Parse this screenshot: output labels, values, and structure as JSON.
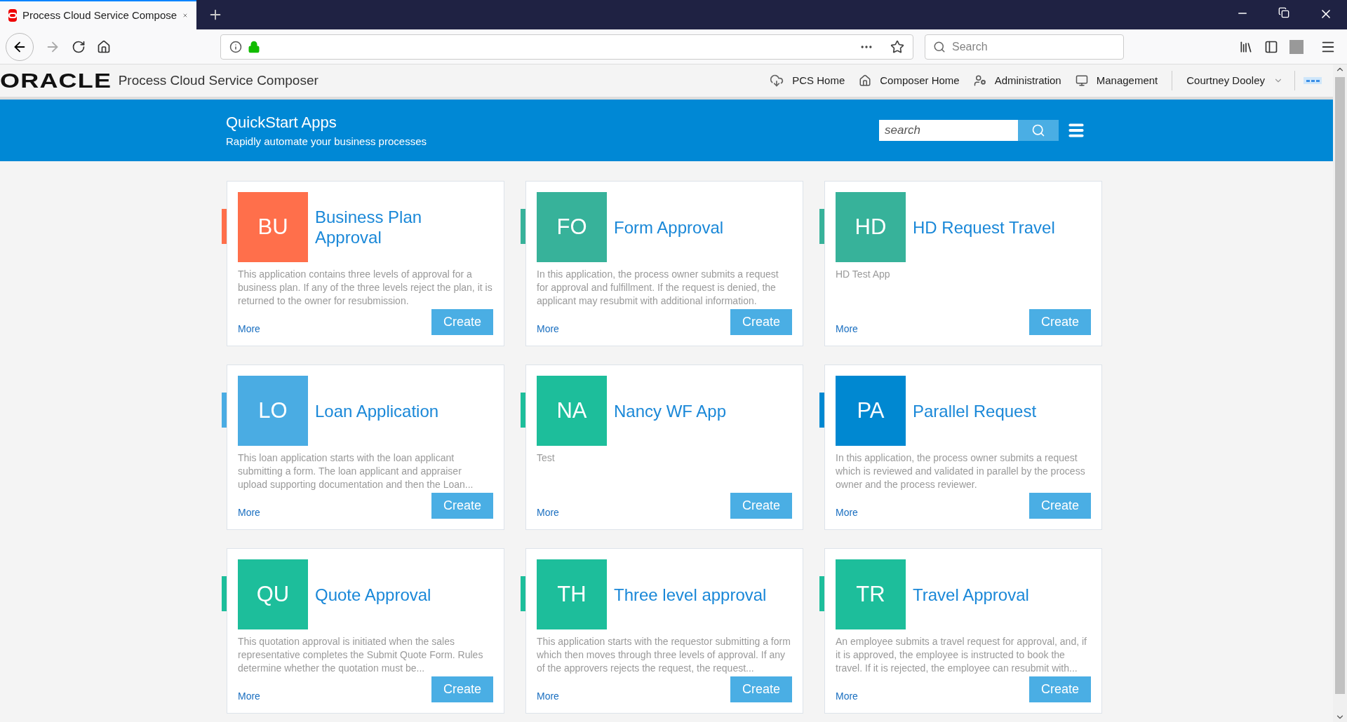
{
  "browser": {
    "tab": {
      "title": "Process Cloud Service Compose",
      "selected": true
    },
    "search": {
      "placeholder": "Search"
    }
  },
  "header": {
    "logo": "ORACLE",
    "product": "Process Cloud Service Composer",
    "nav": [
      {
        "kind": "cloud",
        "label": "PCS Home"
      },
      {
        "kind": "home",
        "label": "Composer Home"
      },
      {
        "kind": "admin",
        "label": "Administration"
      },
      {
        "kind": "monitor",
        "label": "Management"
      }
    ],
    "user": "Courtney Dooley"
  },
  "banner": {
    "title": "QuickStart Apps",
    "subtitle": "Rapidly automate your business processes",
    "search": {
      "placeholder": "search"
    }
  },
  "apps": [
    {
      "initials": "BU",
      "title": "Business Plan Approval",
      "color": "#ff6f4b",
      "description": "This application contains three levels of approval for a business plan. If any of the three levels reject the plan, it is returned to the owner for resubmission.",
      "more": "More",
      "action": "Create"
    },
    {
      "initials": "FO",
      "title": "Form Approval",
      "color": "#37b29a",
      "description": "In this application, the process owner submits a request for approval and fulfillment. If the request is denied, the applicant may resubmit with additional information.",
      "more": "More",
      "action": "Create"
    },
    {
      "initials": "HD",
      "title": "HD Request Travel",
      "color": "#37b29a",
      "description": "HD Test App",
      "more": "More",
      "action": "Create"
    },
    {
      "initials": "LO",
      "title": "Loan Application",
      "color": "#4aace3",
      "description": "This loan application starts with the loan applicant submitting a form. The loan applicant and appraiser upload supporting documentation and then the Loan...",
      "more": "More",
      "action": "Create"
    },
    {
      "initials": "NA",
      "title": "Nancy WF App",
      "color": "#1dbe9b",
      "description": "Test",
      "more": "More",
      "action": "Create"
    },
    {
      "initials": "PA",
      "title": "Parallel Request",
      "color": "#0088d1",
      "description": "In this application, the process owner submits a request which is reviewed and validated in parallel by the process owner and the process reviewer.",
      "more": "More",
      "action": "Create"
    },
    {
      "initials": "QU",
      "title": "Quote Approval",
      "color": "#1dbe9b",
      "description": "This quotation approval is initiated when the sales representative completes the Submit Quote Form. Rules determine whether the quotation must be...",
      "more": "More",
      "action": "Create"
    },
    {
      "initials": "TH",
      "title": "Three level approval",
      "color": "#1dbe9b",
      "description": "This application starts with the requestor submitting a form which then moves through three levels of approval. If any of the approvers rejects the request, the request...",
      "more": "More",
      "action": "Create"
    },
    {
      "initials": "TR",
      "title": "Travel Approval",
      "color": "#1dbe9b",
      "description": "An employee submits a travel request for approval, and, if it is approved, the employee is instructed to book the travel. If it is rejected, the employee can resubmit with...",
      "more": "More",
      "action": "Create"
    }
  ]
}
